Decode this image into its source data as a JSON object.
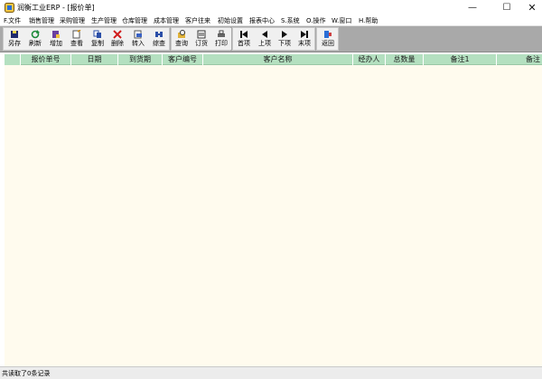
{
  "window": {
    "title": "润衡工业ERP - [报价单]",
    "minimize_glyph": "—",
    "maximize_glyph": "☐",
    "close_glyph": "✕"
  },
  "menu": {
    "items": [
      "F.文件",
      "销售管理",
      "采购管理",
      "生产管理",
      "仓库管理",
      "成本管理",
      "客户往来",
      "初始设置",
      "报表中心",
      "S.系统",
      "O.操作",
      "W.窗口",
      "H.帮助"
    ]
  },
  "toolbar": {
    "buttons": [
      {
        "label": "另存",
        "icon": "save-as-icon"
      },
      {
        "label": "刷新",
        "icon": "refresh-icon"
      },
      {
        "label": "增加",
        "icon": "add-icon"
      },
      {
        "label": "查看",
        "icon": "view-icon"
      },
      {
        "label": "复制",
        "icon": "copy-icon"
      },
      {
        "label": "删除",
        "icon": "delete-icon"
      },
      {
        "label": "转入",
        "icon": "import-icon"
      },
      {
        "label": "综查",
        "icon": "search-all-icon"
      },
      {
        "label": "查询",
        "icon": "query-icon"
      },
      {
        "label": "订货",
        "icon": "order-icon"
      },
      {
        "label": "打印",
        "icon": "print-icon"
      },
      {
        "label": "首项",
        "icon": "first-record-icon"
      },
      {
        "label": "上项",
        "icon": "previous-record-icon"
      },
      {
        "label": "下项",
        "icon": "next-record-icon"
      },
      {
        "label": "末项",
        "icon": "last-record-icon"
      },
      {
        "label": "返回",
        "icon": "return-icon"
      }
    ]
  },
  "grid": {
    "columns": [
      "报价单号",
      "日期",
      "到货期",
      "客户编号",
      "客户名称",
      "经办人",
      "总数量",
      "备注1",
      "备注"
    ]
  },
  "status": {
    "text": "共读取了0条记录"
  },
  "colors": {
    "toolbar_bg": "#a9a9a9",
    "header_bg": "#b4e0c0",
    "grid_bg": "#fffbee"
  }
}
